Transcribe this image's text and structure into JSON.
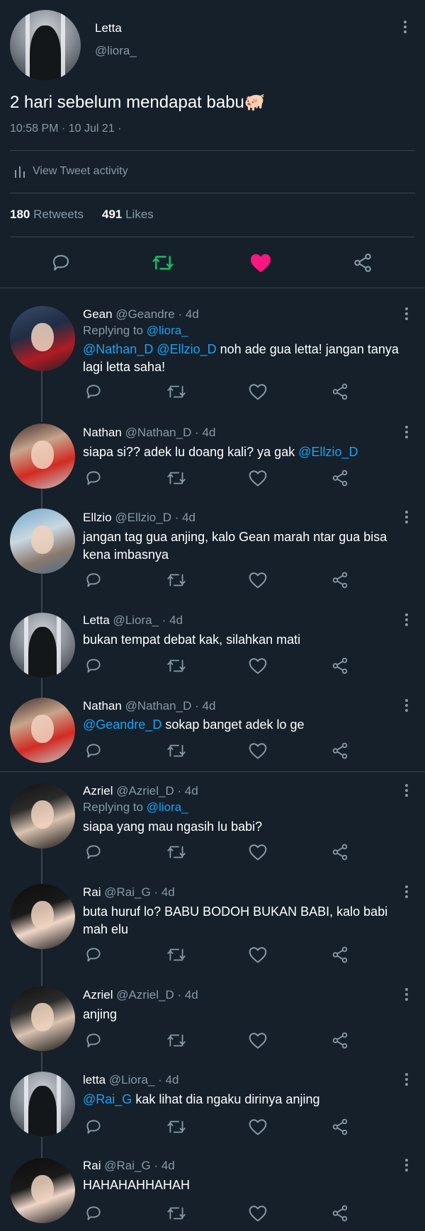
{
  "main": {
    "name": "Letta",
    "handle": "@liora_",
    "text": "2 hari sebelum mendapat babu🐖",
    "timestamp": "10:58 PM · 10 Jul 21 ·",
    "activity_label": "View Tweet activity",
    "retweets_count": "180",
    "retweets_label": "Retweets",
    "likes_count": "491",
    "likes_label": "Likes",
    "colors": {
      "like": "#f91880",
      "retweet": "#17bf63",
      "link": "#1da1f2",
      "muted": "#8899a6",
      "background": "#15202b"
    }
  },
  "replies": [
    {
      "name": "Gean",
      "handle": "@Geandre",
      "time": "· 4d",
      "replying_prefix": "Replying to",
      "replying_to": "@liora_",
      "mention1": "@Nathan_D",
      "mention2": "@Ellzio_D",
      "text": "noh ade gua letta! jangan tanya lagi letta saha!"
    },
    {
      "name": "Nathan",
      "handle": "@Nathan_D",
      "time": "· 4d",
      "text": "siapa si?? adek lu doang kali? ya gak",
      "mention_end": "@Ellzio_D"
    },
    {
      "name": "Ellzio",
      "handle": "@Ellzio_D",
      "time": "· 4d",
      "text": "jangan tag gua anjing, kalo Gean marah ntar gua bisa kena imbasnya"
    },
    {
      "name": "Letta",
      "handle": "@Liora_",
      "time": "· 4d",
      "text": "bukan tempat debat kak, silahkan mati"
    },
    {
      "name": "Nathan",
      "handle": "@Nathan_D",
      "time": "· 4d",
      "mention": "@Geandre_D",
      "text": "sokap banget adek lo ge"
    },
    {
      "name": "Azriel",
      "handle": "@Azriel_D",
      "time": "· 4d",
      "replying_prefix": "Replying to",
      "replying_to": "@liora_",
      "text": "siapa yang mau ngasih lu babi?"
    },
    {
      "name": "Rai",
      "handle": "@Rai_G",
      "time": "· 4d",
      "text": "buta huruf lo? BABU BODOH BUKAN BABI, kalo babi mah elu"
    },
    {
      "name": "Azriel",
      "handle": "@Azriel_D",
      "time": "· 4d",
      "text": "anjing"
    },
    {
      "name": "letta",
      "handle": "@Liora_",
      "time": "· 4d",
      "mention": "@Rai_G",
      "text": "kak lihat dia ngaku dirinya anjing"
    },
    {
      "name": "Rai",
      "handle": "@Rai_G",
      "time": "· 4d",
      "text": "HAHAHAHHAHAH"
    }
  ]
}
